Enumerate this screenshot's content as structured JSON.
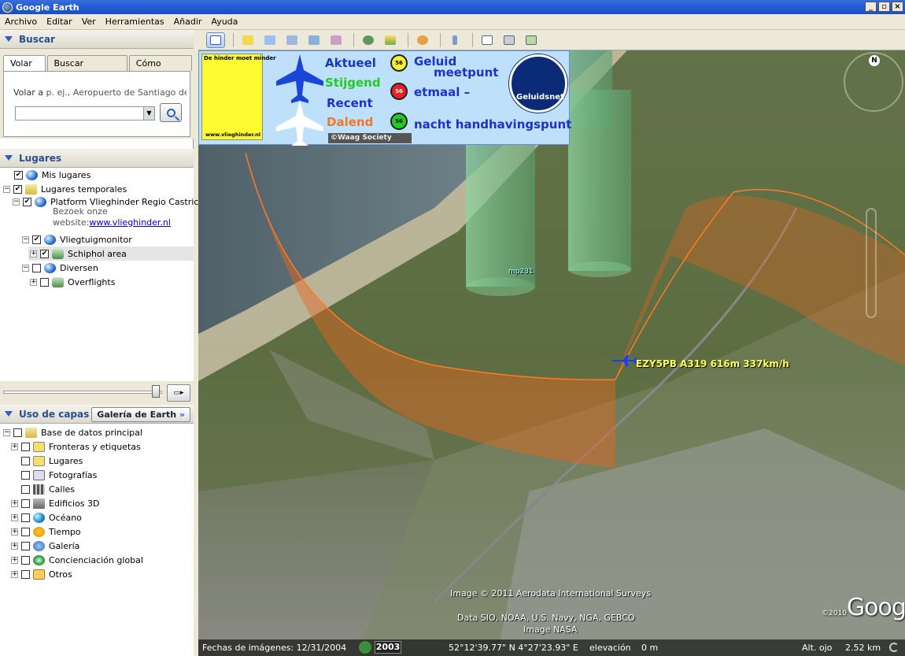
{
  "window": {
    "title": "Google Earth"
  },
  "menu": [
    "Archivo",
    "Editar",
    "Ver",
    "Herramientas",
    "Añadir",
    "Ayuda"
  ],
  "search": {
    "header": "Buscar",
    "tabs": [
      "Volar a",
      "Buscar negocios",
      "Cómo llegar"
    ],
    "flyto_label": "Volar a",
    "flyto_placeholder": "p. ej., Aeropuerto de Santiago de Ch",
    "input_value": ""
  },
  "places": {
    "header": "Lugares",
    "items": [
      {
        "label": "Mis lugares"
      },
      {
        "label": "Lugares temporales"
      },
      {
        "label": "Platform Vlieghinder Regio Castricum",
        "desc1": "Bezoek onze",
        "desc2": "website:",
        "link": "www.vlieghinder.nl"
      },
      {
        "label": "Vliegtuigmonitor"
      },
      {
        "label": "Schiphol area"
      },
      {
        "label": "Diversen"
      },
      {
        "label": "Overflights"
      }
    ]
  },
  "layers": {
    "header": "Uso de capas",
    "gallery_label": "Galería de Earth",
    "items": [
      {
        "label": "Base de datos principal"
      },
      {
        "label": "Fronteras y etiquetas"
      },
      {
        "label": "Lugares"
      },
      {
        "label": "Fotografías"
      },
      {
        "label": "Calles"
      },
      {
        "label": "Edificios 3D"
      },
      {
        "label": "Océano"
      },
      {
        "label": "Tiempo"
      },
      {
        "label": "Galería"
      },
      {
        "label": "Concienciación global"
      },
      {
        "label": "Otros"
      }
    ]
  },
  "legend": {
    "hinder_top": "De hinder moet minder",
    "hinder_bottom": "www.vlieghinder.nl",
    "aktueel": "Aktueel",
    "stijgend": "Stijgend",
    "recent": "Recent",
    "dalend": "Dalend",
    "geluid": "Geluid",
    "meetpunt": "meetpunt",
    "etmaal": "etmaal –",
    "nacht": "nacht handhavingspunt",
    "dot_label": "56",
    "waag": "©Waag Society",
    "geluidsnet": "Geluidsnet"
  },
  "map": {
    "flight_label": "EZY5PB A319 616m 337km/h",
    "marker_label": "mp231",
    "credit1": "Image © 2011 Aerodata International Surveys",
    "credit2": "Data SIO, NOAA, U.S. Navy, NGA, GEBCO",
    "credit3": "Image NASA",
    "google_year": "©2010",
    "google_logo": "Google",
    "compass_n": "N"
  },
  "status": {
    "imagery_date": "Fechas de imágenes: 12/31/2004",
    "year": "2003",
    "coords": "52°12'39.77\" N   4°27'23.93\" E",
    "elevation_label": "elevación",
    "elevation_value": "0 m",
    "eye_alt_label": "Alt. ojo",
    "eye_alt_value": "2.52 km"
  },
  "colors": {
    "titlebar": "#245edb",
    "legend_bg": "#bfe0fb",
    "aktueel": "#1a33c8",
    "stijgend": "#22cc22",
    "recent": "#1a33c8",
    "dalend": "#f07a20",
    "flight_label": "#ffff55",
    "route": "#e8651c"
  }
}
